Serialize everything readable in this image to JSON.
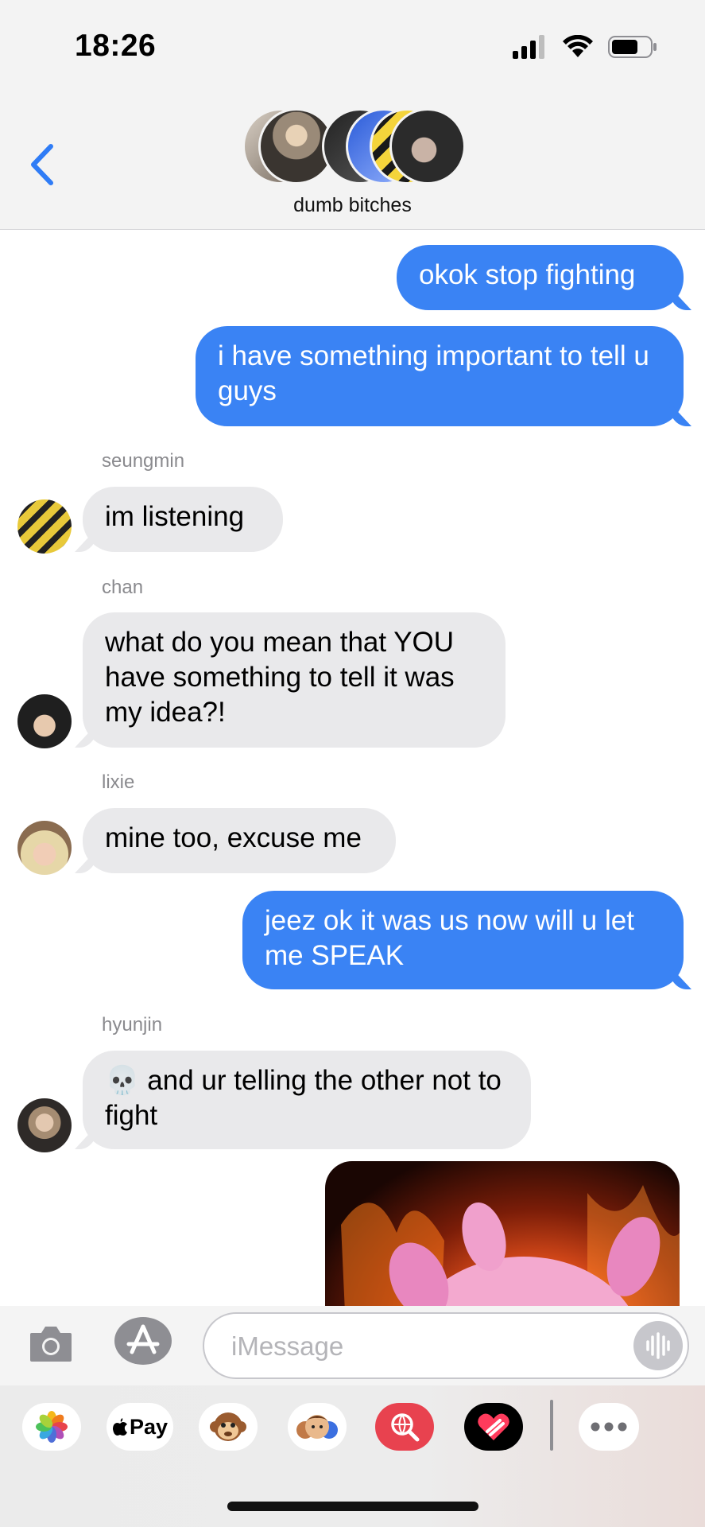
{
  "status_bar": {
    "time": "18:26"
  },
  "header": {
    "group_name": "dumb bitches"
  },
  "messages": [
    {
      "text": "okok stop fighting"
    },
    {
      "text": "i have something important to tell u guys"
    },
    {
      "sender": "seungmin",
      "text": "im listening"
    },
    {
      "sender": "chan",
      "text": "what do you mean that YOU have something to tell it was my idea?!"
    },
    {
      "sender": "lixie",
      "text": "mine too, excuse me"
    },
    {
      "text": "jeez ok it was us now will u let me SPEAK"
    },
    {
      "sender": "hyunjin",
      "text": "💀 and ur telling the other not to fight"
    }
  ],
  "input": {
    "placeholder": "iMessage"
  },
  "drawer": {
    "apple_pay_label": "Pay"
  },
  "colors": {
    "outgoing": "#3a83f4",
    "incoming": "#e9e9eb",
    "accent": "#2f7cf6"
  }
}
